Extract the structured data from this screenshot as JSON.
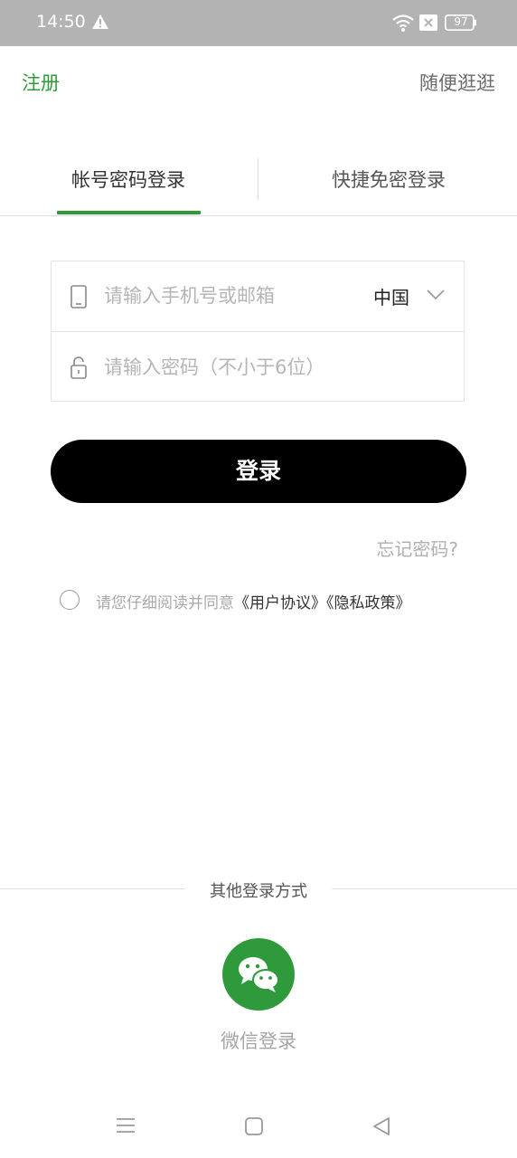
{
  "status_bar": {
    "time": "14:50",
    "battery": "97",
    "icons": [
      "warning-icon",
      "wifi-icon",
      "sim-x-icon",
      "battery-icon"
    ]
  },
  "header": {
    "register": "注册",
    "browse": "随便逛逛"
  },
  "tabs": [
    {
      "label": "帐号密码登录",
      "active": true
    },
    {
      "label": "快捷免密登录",
      "active": false
    }
  ],
  "form": {
    "phone_placeholder": "请输入手机号或邮箱",
    "country": "中国",
    "password_placeholder": "请输入密码（不小于6位）"
  },
  "login_button": "登录",
  "forgot_password": "忘记密码?",
  "agreement": {
    "prefix": "请您仔细阅读并同意",
    "user_agreement": "《用户协议》",
    "privacy_policy": "《隐私政策》"
  },
  "other_login": {
    "title": "其他登录方式",
    "wechat_label": "微信登录"
  },
  "colors": {
    "accent": "#2e9a3c",
    "button": "#000000",
    "status_bar": "#b3b3b3"
  }
}
